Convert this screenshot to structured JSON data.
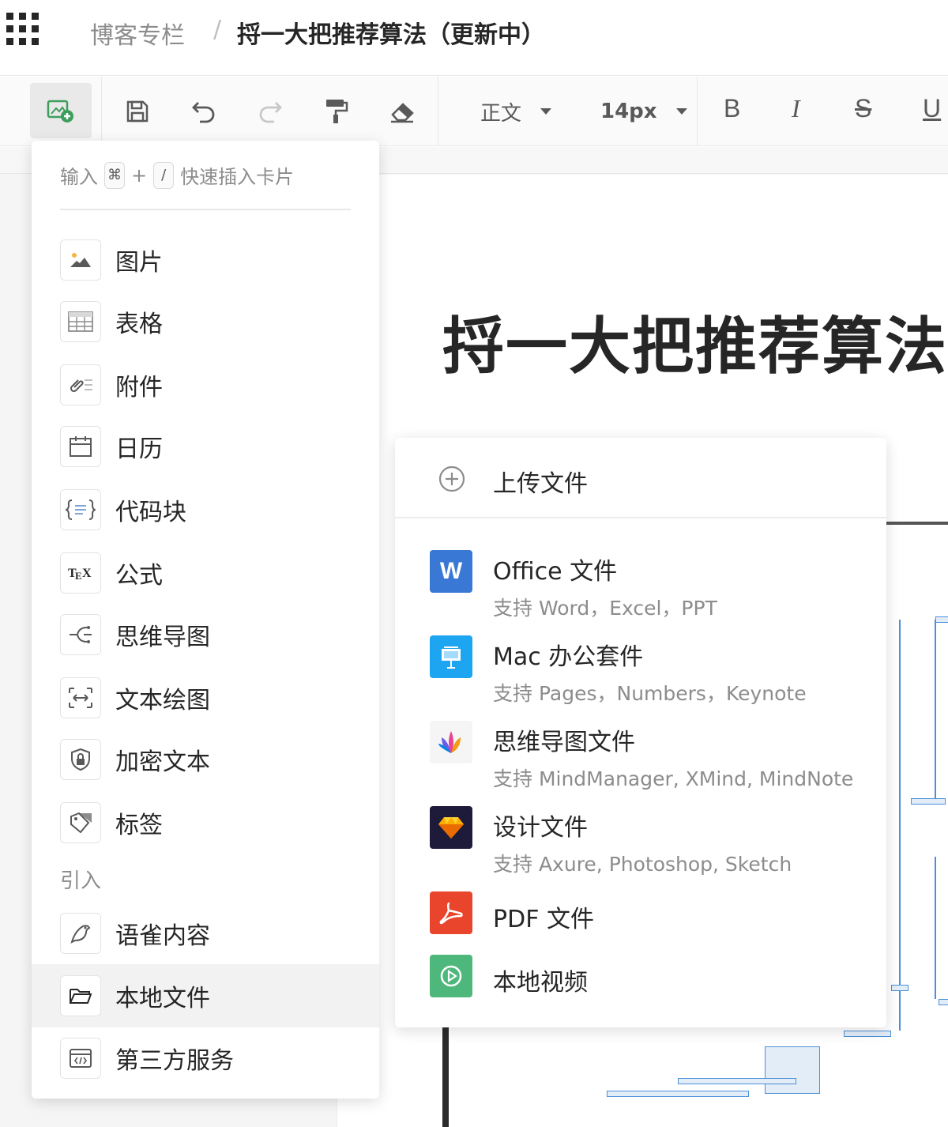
{
  "header": {
    "breadcrumb_parent": "博客专栏",
    "breadcrumb_separator": "/",
    "breadcrumb_current": "捋一大把推荐算法（更新中）"
  },
  "toolbar": {
    "paragraph_style": "正文",
    "font_size": "14px",
    "bold": "B",
    "italic": "I",
    "strikethrough": "S",
    "underline": "U"
  },
  "document": {
    "title": "捋一大把推荐算法"
  },
  "insert_menu": {
    "hint_prefix": "输入",
    "hint_key1": "⌘",
    "hint_plus": "+",
    "hint_key2": "/",
    "hint_suffix": "快速插入卡片",
    "items": [
      {
        "label": "图片",
        "icon": "image-icon"
      },
      {
        "label": "表格",
        "icon": "table-icon"
      },
      {
        "label": "附件",
        "icon": "attachment-icon"
      },
      {
        "label": "日历",
        "icon": "calendar-icon"
      },
      {
        "label": "代码块",
        "icon": "code-block-icon"
      },
      {
        "label": "公式",
        "icon": "tex-formula-icon"
      },
      {
        "label": "思维导图",
        "icon": "mindmap-icon"
      },
      {
        "label": "文本绘图",
        "icon": "text-drawing-icon"
      },
      {
        "label": "加密文本",
        "icon": "lock-shield-icon"
      },
      {
        "label": "标签",
        "icon": "tag-icon"
      }
    ],
    "section_title": "引入",
    "import_items": [
      {
        "label": "语雀内容",
        "icon": "yuque-bird-icon"
      },
      {
        "label": "本地文件",
        "icon": "folder-open-icon"
      },
      {
        "label": "第三方服务",
        "icon": "embed-code-icon"
      }
    ]
  },
  "local_file_menu": {
    "upload_label": "上传文件",
    "items": [
      {
        "title": "Office 文件",
        "desc": "支持 Word，Excel，PPT",
        "icon": "word-icon",
        "color": "#3a78d6"
      },
      {
        "title": "Mac 办公套件",
        "desc": "支持 Pages，Numbers，Keynote",
        "icon": "keynote-icon",
        "color": "#1ea5f2"
      },
      {
        "title": "思维导图文件",
        "desc": "支持 MindManager, XMind, MindNote",
        "icon": "mindnode-icon",
        "color": "#f5f5f5"
      },
      {
        "title": "设计文件",
        "desc": "支持 Axure, Photoshop, Sketch",
        "icon": "sketch-diamond-icon",
        "color": "#1d1a3a"
      },
      {
        "title": "PDF 文件",
        "desc": "",
        "icon": "pdf-icon",
        "color": "#e8452c"
      },
      {
        "title": "本地视频",
        "desc": "",
        "icon": "video-play-icon",
        "color": "#4eb87c"
      }
    ]
  }
}
